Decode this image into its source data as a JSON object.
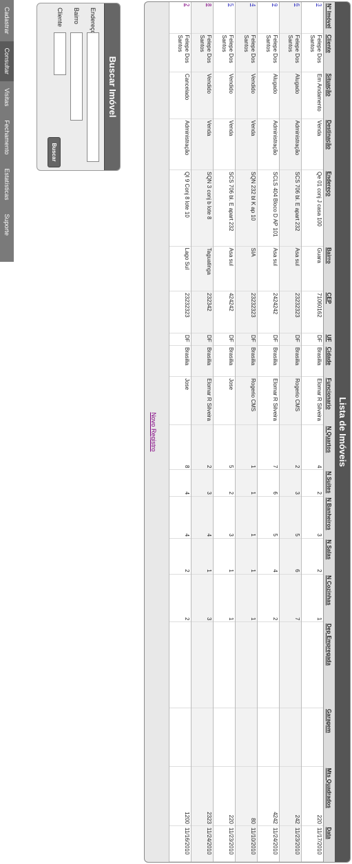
{
  "nav": {
    "items": [
      "Cadastrar",
      "Consultar",
      "Visitas",
      "Fechamento",
      "Estatísticas",
      "Suporte"
    ],
    "active": 1
  },
  "search": {
    "title": "Buscar Imóvel",
    "endereco_label": "Endereço",
    "bairro_label": "Bairro",
    "cliente_label": "Cliente",
    "endereco_value": "",
    "bairro_value": "",
    "cliente_value": "",
    "button_label": "Buscar"
  },
  "table": {
    "title": "Lista de Imóveis",
    "headers": [
      "Nº Imóvel",
      "Cliente",
      "Situação",
      "Destinação",
      "Endereço",
      "Bairro",
      "CEP",
      "UF",
      "Cidade",
      "Funcionario",
      "N Quartos",
      "N Suites",
      "N Banheiros",
      "N Salas",
      "N Cozinhas",
      "Dep Empregada",
      "Garagem",
      "Mts Quadrados",
      "Data"
    ],
    "rows": [
      [
        "3",
        "Felepe Dos Santos",
        "Em Andamento",
        "Venda",
        "Qe 01 conj J casa 100",
        "Guara",
        "71060162",
        "DF",
        "Brasilia",
        "Elomar R Silveira",
        "4",
        "2",
        "3",
        "2",
        "1",
        "",
        "",
        "220",
        "11/17/2010"
      ],
      [
        "6",
        "Felepe Dos Santos",
        "Alugado",
        "Administração",
        "SCS 706 bl. E apart 232",
        "Asa sul",
        "23232323",
        "DF",
        "Brasilia",
        "Rogerio CMS",
        "2",
        "3",
        "5",
        "6",
        "7",
        "",
        "",
        "242",
        "11/23/2010"
      ],
      [
        "9",
        "Felepe Dos Santos",
        "Alugado",
        "Administração",
        "SCLS 404 Bloco D AP 101",
        "Asa sul",
        "2424242",
        "DF",
        "Brasilia",
        "Elomar R Silveira",
        "7",
        "6",
        "5",
        "4",
        "2",
        "",
        "",
        "4242",
        "11/24/2010"
      ],
      [
        "4",
        "Felepe Dos Santos",
        "Vendido",
        "Venda",
        "SQN 232 bl K ap 10",
        "SIA",
        "23232323",
        "DF",
        "Brasilia",
        "Rogerio CMS",
        "1",
        "1",
        "1",
        "1",
        "1",
        "",
        "",
        "80",
        "11/10/2010"
      ],
      [
        "5",
        "Felepe Dos Santos",
        "Vendido",
        "Venda",
        "SCS 706 bl. E apart 232",
        "Asa sul",
        "424242",
        "DF",
        "Brasilia",
        "Jose",
        "5",
        "2",
        "3",
        "1",
        "1",
        "",
        "",
        "220",
        "11/23/2010"
      ],
      [
        "8",
        "Felepe Dos Santos",
        "Vendido",
        "Venda",
        "SQN 3 conj b lote 8",
        "Taguatinga",
        "232342",
        "DF",
        "Brasilia",
        "Elomar R Silveira",
        "2",
        "3",
        "4",
        "1",
        "3",
        "",
        "",
        "2323",
        "11/24/2010"
      ],
      [
        "2",
        "Felepe Dos Santos",
        "Cancelado",
        "Administração",
        "QI 9 Conj 8 lote 10",
        "Lago Sul",
        "23232323",
        "DF",
        "Brasilia",
        "Jose",
        "8",
        "4",
        "4",
        "2",
        "2",
        "",
        "",
        "1200",
        "11/16/2010"
      ]
    ],
    "visited_ids": [
      "8",
      "2"
    ],
    "new_record_label": "Novo Registro"
  }
}
